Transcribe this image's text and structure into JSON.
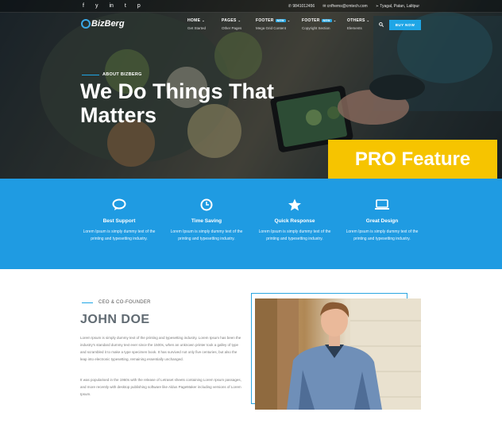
{
  "topbar": {
    "social": [
      "f",
      "y",
      "in",
      "t",
      "p"
    ],
    "phone": "9841012456",
    "email": "cnfhems@cmtech.com",
    "address": "Tyagal, Patan, Lalitpur"
  },
  "brand": {
    "logo_text": "BizBerg"
  },
  "nav": [
    {
      "title": "HOME",
      "sub": "Get Started",
      "badge": ""
    },
    {
      "title": "PAGES",
      "sub": "Other Pages",
      "badge": ""
    },
    {
      "title": "FOOTER",
      "sub": "Mega Grid Content",
      "badge": "NEW"
    },
    {
      "title": "FOOTER",
      "sub": "Copyright Section",
      "badge": "NEW"
    },
    {
      "title": "OTHERS",
      "sub": "Elements",
      "badge": ""
    }
  ],
  "buy_button": "BUY NOW",
  "hero": {
    "label": "ABOUT BIZBERG",
    "title": "We Do Things That Matters"
  },
  "pro_badge": "PRO Feature",
  "features": [
    {
      "icon": "chat-icon",
      "title": "Best Support",
      "desc": "Lorem Ipsum is simply dummy text of the printing and typesetting industry."
    },
    {
      "icon": "clock-icon",
      "title": "Time Saving",
      "desc": "Lorem Ipsum is simply dummy text of the printing and typesetting industry."
    },
    {
      "icon": "star-icon",
      "title": "Quick Response",
      "desc": "Lorem Ipsum is simply dummy text of the printing and typesetting industry."
    },
    {
      "icon": "laptop-icon",
      "title": "Great Design",
      "desc": "Lorem Ipsum is simply dummy text of the printing and typesetting industry."
    }
  ],
  "ceo": {
    "label": "CEO & CO-FOUNDER",
    "name": "JOHN DOE",
    "p1": "Lorem Ipsum is simply dummy text of the printing and typesetting industry. Lorem Ipsum has been the industry's standard dummy text ever since the 1500s, when an unknown printer took a galley of type and scrambled it to make a type specimen book. It has survived not only five centuries, but also the leap into electronic typesetting, remaining essentially unchanged.",
    "p2": "It was popularised in the 1960s with the release of Letraset sheets containing Lorem Ipsum passages, and more recently with desktop publishing software like Aldus PageMaker including versions of Lorem Ipsum."
  },
  "colors": {
    "accent": "#1f9be2",
    "pro": "#f6c400"
  }
}
